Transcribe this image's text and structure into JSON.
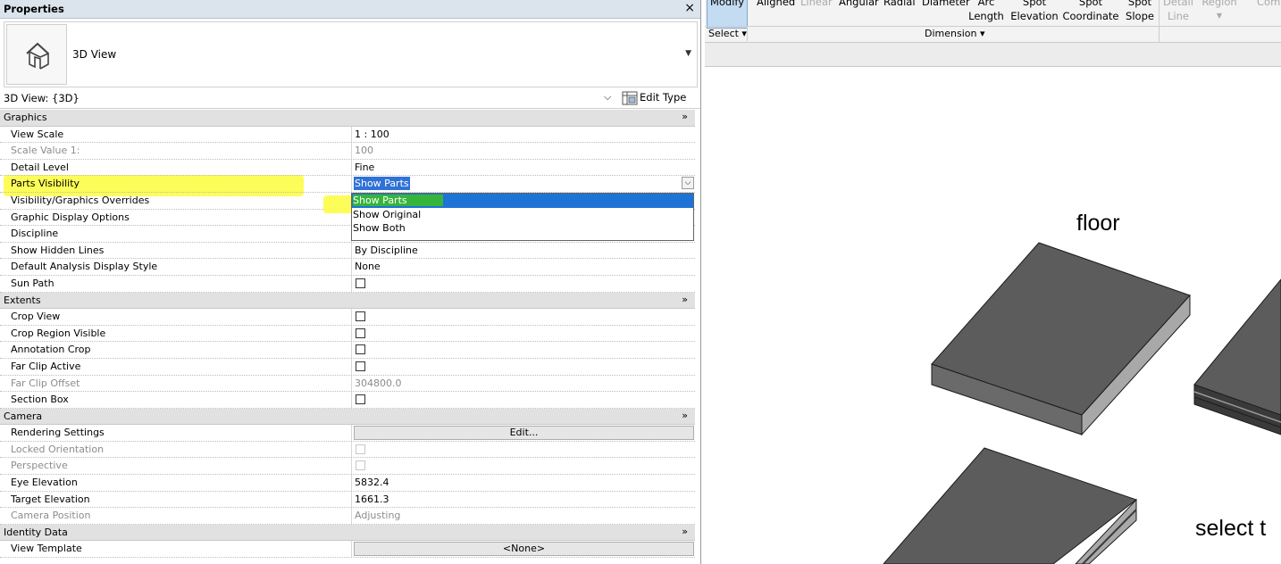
{
  "properties": {
    "title": "Properties",
    "close_glyph": "×",
    "type_name": "3D View",
    "view_selector": "3D View: {3D}",
    "edit_type_label": "Edit Type",
    "groups": {
      "graphics": "Graphics",
      "extents": "Extents",
      "camera": "Camera",
      "identity": "Identity Data"
    },
    "rows": {
      "view_scale": {
        "label": "View Scale",
        "value": "1 : 100"
      },
      "scale_value": {
        "label": "Scale Value    1:",
        "value": "100"
      },
      "detail_level": {
        "label": "Detail Level",
        "value": "Fine"
      },
      "parts_visibility": {
        "label": "Parts Visibility",
        "value": "Show Parts"
      },
      "vg_overrides": {
        "label": "Visibility/Graphics Overrides"
      },
      "graphic_display": {
        "label": "Graphic Display Options"
      },
      "discipline": {
        "label": "Discipline"
      },
      "show_hidden": {
        "label": "Show Hidden Lines",
        "value": "By Discipline"
      },
      "analysis_style": {
        "label": "Default Analysis Display Style",
        "value": "None"
      },
      "sun_path": {
        "label": "Sun Path"
      },
      "crop_view": {
        "label": "Crop View"
      },
      "crop_region": {
        "label": "Crop Region Visible"
      },
      "annotation_crop": {
        "label": "Annotation Crop"
      },
      "far_clip_active": {
        "label": "Far Clip Active"
      },
      "far_clip_offset": {
        "label": "Far Clip Offset",
        "value": "304800.0"
      },
      "section_box": {
        "label": "Section Box"
      },
      "rendering": {
        "label": "Rendering Settings",
        "value": "Edit..."
      },
      "locked_orient": {
        "label": "Locked Orientation"
      },
      "perspective": {
        "label": "Perspective"
      },
      "eye_elev": {
        "label": "Eye Elevation",
        "value": "5832.4"
      },
      "target_elev": {
        "label": "Target Elevation",
        "value": "1661.3"
      },
      "camera_pos": {
        "label": "Camera Position",
        "value": "Adjusting"
      },
      "view_template": {
        "label": "View Template",
        "value": "<None>"
      }
    },
    "dropdown_options": [
      "Show Parts",
      "Show Original",
      "Show Both"
    ],
    "dropdown_selected": "Show Parts"
  },
  "ribbon": {
    "modify": "Modify",
    "tools": {
      "aligned": "Aligned",
      "linear": "Linear",
      "angular": "Angular",
      "radial": "Radial",
      "diameter": "Diameter",
      "arc_top": "Arc",
      "arc_bottom": "Length",
      "spot_elev_top": "Spot",
      "spot_elev_bottom": "Elevation",
      "spot_coord_top": "Spot",
      "spot_coord_bottom": "Coordinate",
      "spot_slope_top": "Spot",
      "spot_slope_bottom": "Slope",
      "detail_top": "Detail",
      "detail_bottom": "Line",
      "region": "Region",
      "com": "Com"
    },
    "panels": {
      "select": "Select ▾",
      "dimension": "Dimension ▾"
    }
  },
  "canvas": {
    "label_floor": "floor",
    "label_select": "select t"
  },
  "colors": {
    "highlight": "#fdfd3c",
    "selection_blue": "#1e73d6",
    "selection_green": "#36b53a",
    "slab_top": "#5c5c5c",
    "slab_side": "#a8a8a8"
  }
}
